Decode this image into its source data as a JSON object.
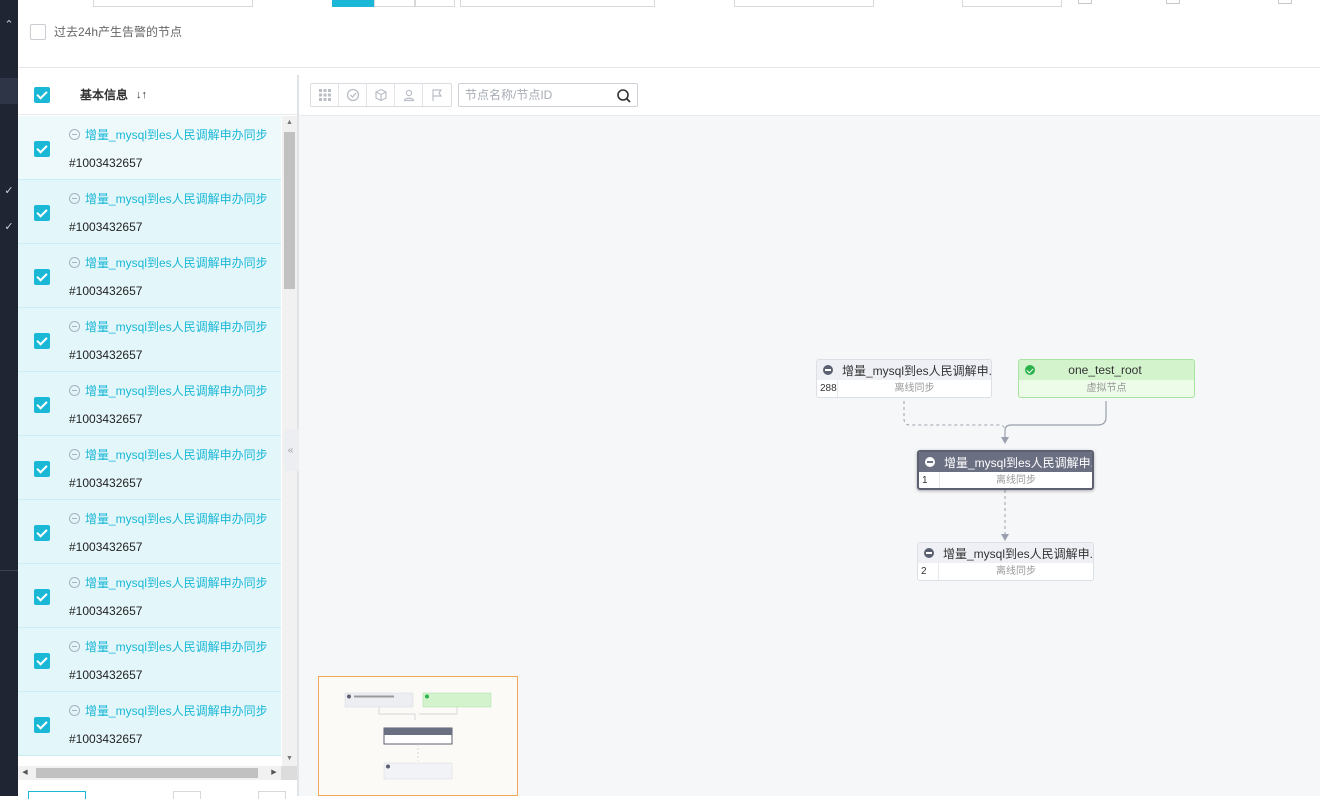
{
  "filters": {
    "alert_24h_label": "过去24h产生告警的节点"
  },
  "list": {
    "header_title": "基本信息",
    "sort_icon": "sort-icon",
    "rows": [
      {
        "name": "增量_mysql到es人民调解申办同步",
        "id": "#1003432657"
      },
      {
        "name": "增量_mysql到es人民调解申办同步",
        "id": "#1003432657"
      },
      {
        "name": "增量_mysql到es人民调解申办同步",
        "id": "#1003432657"
      },
      {
        "name": "增量_mysql到es人民调解申办同步",
        "id": "#1003432657"
      },
      {
        "name": "增量_mysql到es人民调解申办同步",
        "id": "#1003432657"
      },
      {
        "name": "增量_mysql到es人民调解申办同步",
        "id": "#1003432657"
      },
      {
        "name": "增量_mysql到es人民调解申办同步",
        "id": "#1003432657"
      },
      {
        "name": "增量_mysql到es人民调解申办同步",
        "id": "#1003432657"
      },
      {
        "name": "增量_mysql到es人民调解申办同步",
        "id": "#1003432657"
      },
      {
        "name": "增量_mysql到es人民调解申办同步",
        "id": "#1003432657"
      }
    ]
  },
  "graph": {
    "search_placeholder": "节点名称/节点ID",
    "nodes": {
      "upstream": {
        "title": "增量_mysql到es人民调解申...",
        "count": "288",
        "type": "离线同步"
      },
      "root": {
        "title": "one_test_root",
        "type": "虚拟节点"
      },
      "current": {
        "title": "增量_mysql到es人民调解申...",
        "count": "1",
        "type": "离线同步"
      },
      "downstream": {
        "title": "增量_mysql到es人民调解申...",
        "count": "2",
        "type": "离线同步"
      }
    }
  },
  "colors": {
    "accent": "#1ab8d6",
    "sidebar": "#1f2533",
    "selected_node": "#6b6f82",
    "root_node": "#d3f3cc",
    "minimap_border": "#f2a65a"
  }
}
